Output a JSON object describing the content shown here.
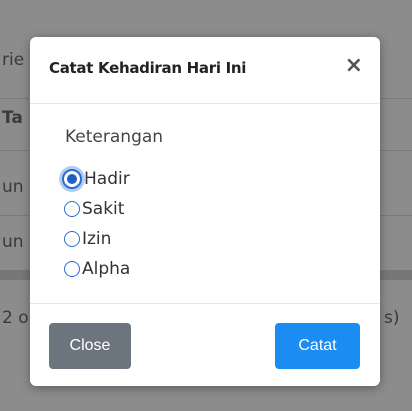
{
  "background": {
    "fragments": [
      "rie",
      "Ta",
      "un",
      "un",
      "2 o",
      "s)"
    ]
  },
  "modal": {
    "title": "Catat Kehadiran Hari Ini",
    "close_icon": "×",
    "field_label": "Keterangan",
    "options": [
      {
        "label": "Hadir",
        "checked": true
      },
      {
        "label": "Sakit",
        "checked": false
      },
      {
        "label": "Izin",
        "checked": false
      },
      {
        "label": "Alpha",
        "checked": false
      }
    ],
    "close_button": "Close",
    "submit_button": "Catat"
  },
  "colors": {
    "primary": "#1a8cf2",
    "secondary": "#6c757d",
    "radio": "#2b6cd4"
  }
}
